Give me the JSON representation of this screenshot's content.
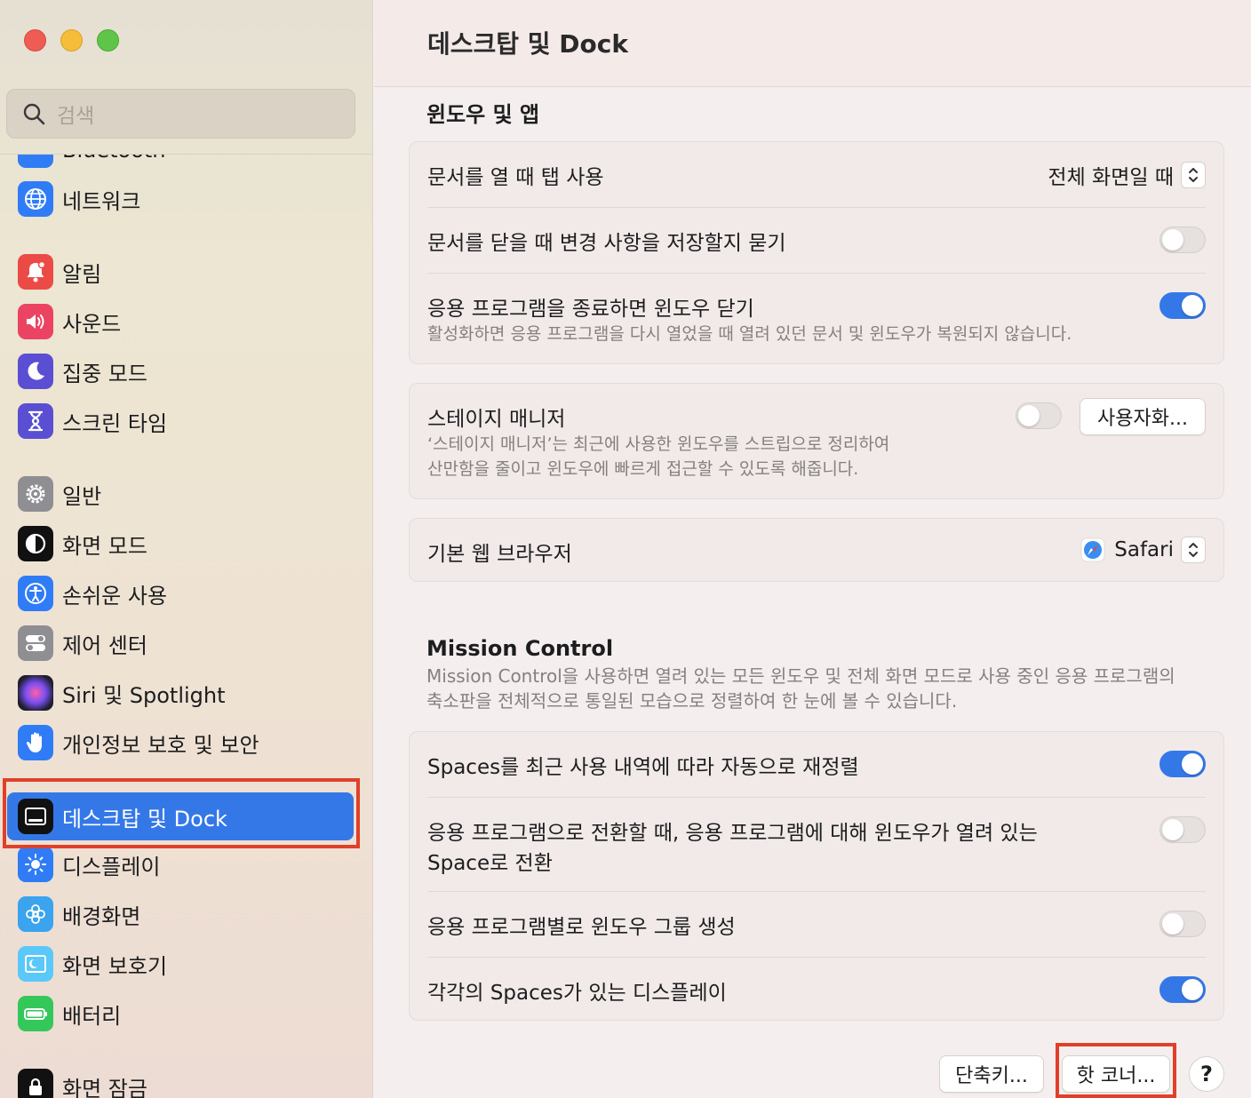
{
  "sidebar": {
    "search_placeholder": "검색",
    "partial_item": "Bluetooth",
    "items": [
      {
        "label": "네트워크"
      },
      {
        "label": "알림"
      },
      {
        "label": "사운드"
      },
      {
        "label": "집중 모드"
      },
      {
        "label": "스크린 타임"
      },
      {
        "label": "일반"
      },
      {
        "label": "화면 모드"
      },
      {
        "label": "손쉬운 사용"
      },
      {
        "label": "제어 센터"
      },
      {
        "label": "Siri 및 Spotlight"
      },
      {
        "label": "개인정보 보호 및 보안"
      },
      {
        "label": "데스크탑 및 Dock",
        "selected": true
      },
      {
        "label": "디스플레이"
      },
      {
        "label": "배경화면"
      },
      {
        "label": "화면 보호기"
      },
      {
        "label": "배터리"
      },
      {
        "label": "화면 잠금"
      }
    ]
  },
  "header": {
    "title": "데스크탑 및 Dock"
  },
  "windows_apps": {
    "title": "윈도우 및 앱",
    "tabs_label": "문서를 열 때 탭 사용",
    "tabs_value": "전체 화면일 때",
    "ask_save_label": "문서를 닫을 때 변경 사항을 저장할지 묻기",
    "ask_save_on": false,
    "close_windows_label": "응용 프로그램을 종료하면 윈도우 닫기",
    "close_windows_desc": "활성화하면 응용 프로그램을 다시 열었을 때 열려 있던 문서 및 윈도우가 복원되지 않습니다.",
    "close_windows_on": true,
    "stage_label": "스테이지 매니저",
    "stage_desc_1": "‘스테이지 매니저’는 최근에 사용한 윈도우를 스트립으로 정리하여",
    "stage_desc_2": "산만함을 줄이고 윈도우에 빠르게 접근할 수 있도록 해줍니다.",
    "stage_on": false,
    "customize_button": "사용자화...",
    "browser_label": "기본 웹 브라우저",
    "browser_value": "Safari"
  },
  "mission_control": {
    "title": "Mission Control",
    "desc_1": "Mission Control을 사용하면 열려 있는 모든 윈도우 및 전체 화면 모드로 사용 중인 응용 프로그램의",
    "desc_2": "축소판을 전체적으로 통일된 모습으로 정렬하여 한 눈에 볼 수 있습니다.",
    "rearrange_label": "Spaces를 최근 사용 내역에 따라 자동으로 재정렬",
    "rearrange_on": true,
    "switch_label_1": "응용 프로그램으로 전환할 때, 응용 프로그램에 대해 윈도우가 열려 있는",
    "switch_label_2": "Space로 전환",
    "switch_on": false,
    "group_label": "응용 프로그램별로 윈도우 그룹 생성",
    "group_on": false,
    "displays_label": "각각의 Spaces가 있는 디스플레이",
    "displays_on": true
  },
  "footer": {
    "shortcuts_button": "단축키...",
    "hot_corners_button": "핫 코너...",
    "help_button": "?"
  },
  "colors": {
    "accent": "#3478e8",
    "highlight": "#e0402a"
  }
}
